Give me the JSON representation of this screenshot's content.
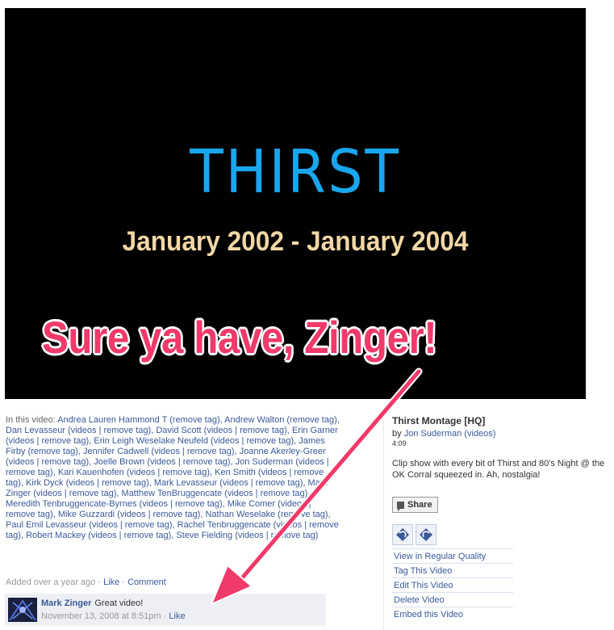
{
  "video": {
    "title_card": "THIRST",
    "dates": "January 2002 - January 2004",
    "overlay_text": "Sure ya have, Zinger!"
  },
  "tags": {
    "label": "In this video:",
    "people": [
      {
        "name": "Andrea Lauren Hammond T",
        "links": [
          "remove tag"
        ]
      },
      {
        "name": "Andrew Walton",
        "links": [
          "remove tag"
        ]
      },
      {
        "name": "Dan Levasseur",
        "links": [
          "videos",
          "remove tag"
        ]
      },
      {
        "name": "David Scott",
        "links": [
          "videos",
          "remove tag"
        ]
      },
      {
        "name": "Erin Garner",
        "links": [
          "videos",
          "remove tag"
        ]
      },
      {
        "name": "Erin Leigh Weselake Neufeld",
        "links": [
          "videos",
          "remove tag"
        ]
      },
      {
        "name": "James Firby",
        "links": [
          "remove tag"
        ]
      },
      {
        "name": "Jennifer Cadwell",
        "links": [
          "videos",
          "remove tag"
        ]
      },
      {
        "name": "Joanne Akerley-Greer",
        "links": [
          "videos",
          "remove tag"
        ]
      },
      {
        "name": "Joelle Brown",
        "links": [
          "videos",
          "remove tag"
        ]
      },
      {
        "name": "Jon Suderman",
        "links": [
          "videos",
          "remove tag"
        ]
      },
      {
        "name": "Kari Kauenhofen",
        "links": [
          "videos",
          "remove tag"
        ]
      },
      {
        "name": "Ken Smith",
        "links": [
          "videos",
          "remove tag"
        ]
      },
      {
        "name": "Kirk Dyck",
        "links": [
          "videos",
          "remove tag"
        ]
      },
      {
        "name": "Mark Levasseur",
        "links": [
          "videos",
          "remove tag"
        ]
      },
      {
        "name": "Mark Zinger",
        "links": [
          "videos",
          "remove tag"
        ]
      },
      {
        "name": "Matthew TenBruggencate",
        "links": [
          "videos",
          "remove tag"
        ]
      },
      {
        "name": "Meredith Tenbruggencate-Byrnes",
        "links": [
          "videos",
          "remove tag"
        ]
      },
      {
        "name": "Mike Comer",
        "links": [
          "videos",
          "remove tag"
        ]
      },
      {
        "name": "Mike Guzzardi",
        "links": [
          "videos",
          "remove tag"
        ]
      },
      {
        "name": "Nathan Weselake",
        "links": [
          "remove tag"
        ]
      },
      {
        "name": "Paul Emil Levasseur",
        "links": [
          "videos",
          "remove tag"
        ]
      },
      {
        "name": "Rachel Tenbruggencate",
        "links": [
          "videos",
          "remove tag"
        ]
      },
      {
        "name": "Robert Mackey",
        "links": [
          "videos",
          "remove tag"
        ]
      },
      {
        "name": "Steve Fielding",
        "links": [
          "videos",
          "remove tag"
        ]
      }
    ]
  },
  "added": {
    "text": "Added over a year ago",
    "sep": "·",
    "like": "Like",
    "comment": "Comment"
  },
  "comment": {
    "author": "Mark Zinger",
    "text": "Great video!",
    "timestamp": "November 13, 2008 at 8:51pm",
    "sep": "·",
    "like": "Like"
  },
  "side": {
    "title": "Thirst Montage [HQ]",
    "by_prefix": "by",
    "author": "Jon Suderman",
    "author_videos": "(videos)",
    "duration": "4:09",
    "description": "Clip show with every bit of Thirst and 80's Night @ the OK Corral squeezed in. Ah, nostalgia!",
    "share_label": "Share",
    "actions": [
      "View in Regular Quality",
      "Tag This Video",
      "Edit This Video",
      "Delete Video",
      "Embed this Video"
    ]
  },
  "colors": {
    "link": "#3b5998",
    "title_blue": "#1aa6ee",
    "dates_cream": "#f2d7a6",
    "annotation_pink": "#f03a6a"
  }
}
